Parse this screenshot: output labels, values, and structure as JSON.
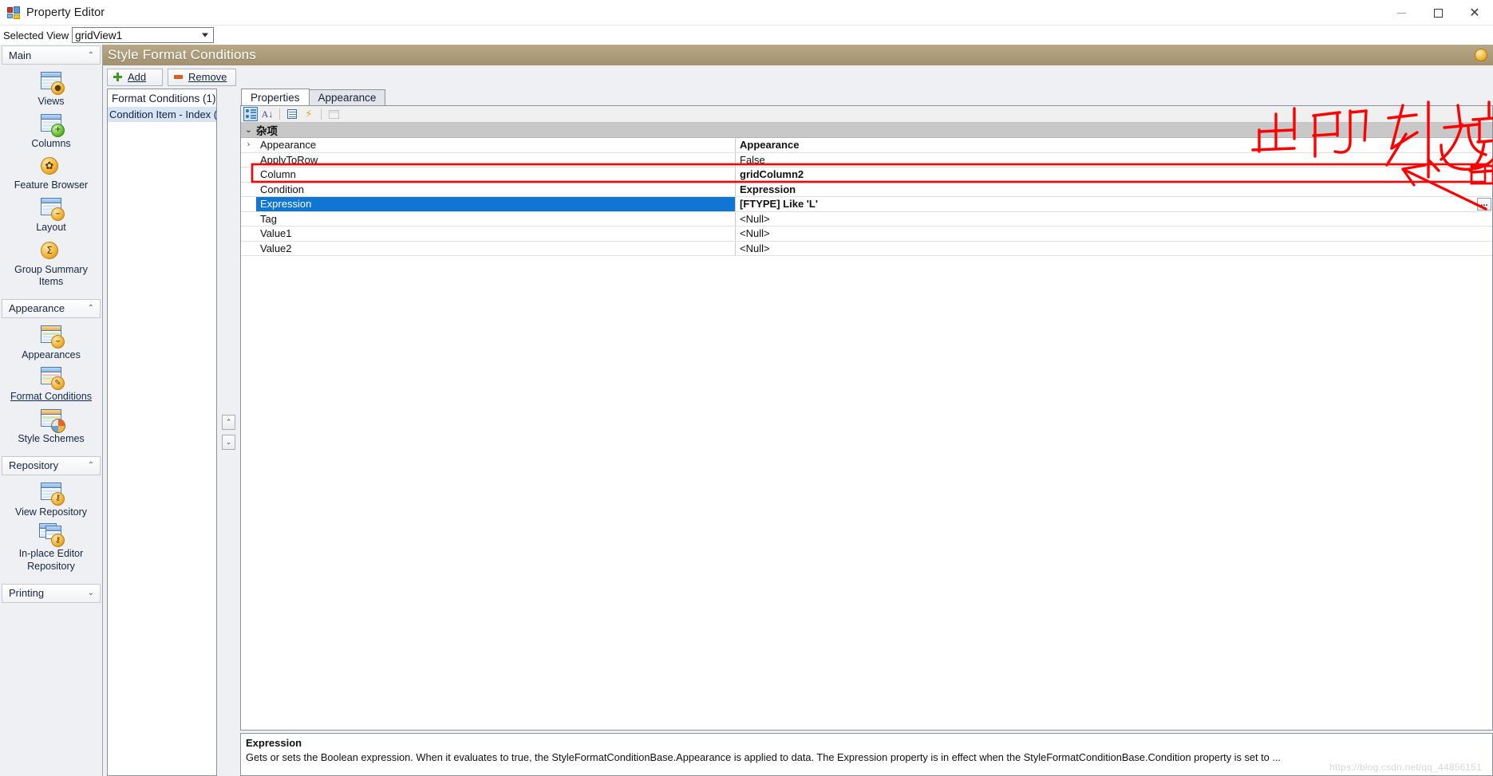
{
  "window": {
    "title": "Property Editor",
    "icon": "app-form-icon",
    "minimize_label": "—",
    "maximize_label": "□",
    "close_label": "✕"
  },
  "selected_view": {
    "label": "Selected View",
    "value": "gridView1",
    "dropdown_icon": "chevron-down-icon"
  },
  "sidebar": {
    "groups": [
      {
        "title": "Main",
        "collapse_icon": "chevron-up-icon",
        "expanded": true,
        "items": [
          {
            "label": "Views",
            "icon": "views-icon",
            "active": false
          },
          {
            "label": "Columns",
            "icon": "columns-icon",
            "active": false
          },
          {
            "label": "Feature Browser",
            "icon": "gear-icon",
            "active": false
          },
          {
            "label": "Layout",
            "icon": "layout-icon",
            "active": false
          },
          {
            "label": "Group Summary Items",
            "icon": "sigma-icon",
            "active": false
          }
        ]
      },
      {
        "title": "Appearance",
        "collapse_icon": "chevron-up-icon",
        "expanded": true,
        "items": [
          {
            "label": "Appearances",
            "icon": "appearances-icon",
            "active": false
          },
          {
            "label": "Format Conditions",
            "icon": "format-conditions-icon",
            "active": true
          },
          {
            "label": "Style Schemes",
            "icon": "style-schemes-icon",
            "active": false
          }
        ]
      },
      {
        "title": "Repository",
        "collapse_icon": "chevron-up-icon",
        "expanded": true,
        "items": [
          {
            "label": "View Repository",
            "icon": "view-repository-icon",
            "active": false
          },
          {
            "label": "In-place Editor Repository",
            "icon": "inplace-editor-repository-icon",
            "active": false
          }
        ]
      },
      {
        "title": "Printing",
        "collapse_icon": "chevron-down-icon",
        "expanded": false,
        "items": []
      }
    ]
  },
  "page": {
    "banner_title": "Style Format Conditions",
    "banner_badge_icon": "pencil-badge-icon"
  },
  "toolbar": {
    "add_label": "Add",
    "add_icon": "plus-icon",
    "remove_label": "Remove",
    "remove_icon": "minus-icon"
  },
  "conditions_panel": {
    "header": "Format Conditions (1)",
    "items": [
      {
        "label": "Condition Item - Index (",
        "selected": true
      }
    ],
    "move_up_icon": "chevron-up-icon",
    "move_down_icon": "chevron-down-icon"
  },
  "tabs": [
    {
      "label": "Properties",
      "active": true
    },
    {
      "label": "Appearance",
      "active": false
    }
  ],
  "property_toolbar": {
    "buttons": [
      {
        "name": "categorized-icon",
        "state": "selected"
      },
      {
        "name": "alphabetical-sort-icon",
        "state": "normal"
      },
      {
        "name": "properties-page-icon",
        "state": "normal"
      },
      {
        "name": "events-bolt-icon",
        "state": "normal"
      },
      {
        "name": "property-pages-window-icon",
        "state": "disabled"
      }
    ]
  },
  "property_grid": {
    "category": "杂项",
    "category_expand_icon": "chevron-down-icon",
    "rows": [
      {
        "name": "Appearance",
        "value": "Appearance",
        "expandable": true,
        "bold_value": true,
        "selected": false,
        "highlight": false,
        "editor": "none"
      },
      {
        "name": "ApplyToRow",
        "value": "False",
        "expandable": false,
        "bold_value": false,
        "selected": false,
        "highlight": false,
        "editor": "none"
      },
      {
        "name": "Column",
        "value": "gridColumn2",
        "expandable": false,
        "bold_value": true,
        "selected": false,
        "highlight": true,
        "editor": "none"
      },
      {
        "name": "Condition",
        "value": "Expression",
        "expandable": false,
        "bold_value": true,
        "selected": false,
        "highlight": false,
        "editor": "none"
      },
      {
        "name": "Expression",
        "value": "[FTYPE] Like 'L'",
        "expandable": false,
        "bold_value": true,
        "selected": true,
        "highlight": false,
        "editor": "ellipsis"
      },
      {
        "name": "Tag",
        "value": "<Null>",
        "expandable": false,
        "bold_value": false,
        "selected": false,
        "highlight": false,
        "editor": "none"
      },
      {
        "name": "Value1",
        "value": "<Null>",
        "expandable": false,
        "bold_value": false,
        "selected": false,
        "highlight": false,
        "editor": "none"
      },
      {
        "name": "Value2",
        "value": "<Null>",
        "expandable": false,
        "bold_value": false,
        "selected": false,
        "highlight": false,
        "editor": "none"
      }
    ],
    "ellipsis_label": "..."
  },
  "description": {
    "title": "Expression",
    "text": "Gets or sets the Boolean expression. When it evaluates to true, the StyleFormatConditionBase.Appearance is applied to data. The Expression property is in effect when the StyleFormatConditionBase.Condition property is set to ..."
  },
  "watermark": "https://blog.csdn.net/qq_44856151",
  "annotation": {
    "handwriting_text": "出现列选定",
    "color": "#FF0000"
  },
  "colors": {
    "banner": "#a2926f",
    "selection": "#0f76d3",
    "annotation_red": "#FF0000",
    "category_row": "#c8c8c8"
  }
}
